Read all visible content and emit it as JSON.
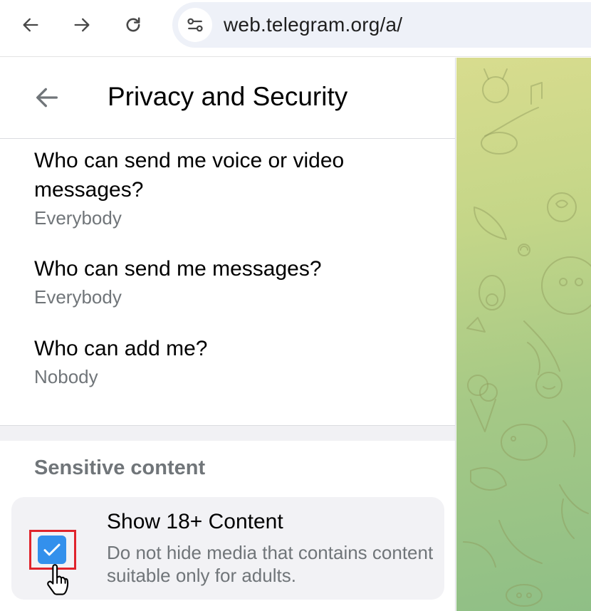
{
  "browser": {
    "url": "web.telegram.org/a/",
    "back_icon": "arrow-left-icon",
    "forward_icon": "arrow-right-icon",
    "reload_icon": "reload-icon",
    "site_info_icon": "tune-icon"
  },
  "header": {
    "title": "Privacy and Security",
    "back_icon": "arrow-left-icon"
  },
  "settings": [
    {
      "label": "Who can send me voice or video messages?",
      "value": "Everybody"
    },
    {
      "label": "Who can send me messages?",
      "value": "Everybody"
    },
    {
      "label": "Who can add me?",
      "value": "Nobody"
    }
  ],
  "sensitive": {
    "section_title": "Sensitive content",
    "option": {
      "title": "Show 18+ Content",
      "description": "Do not hide media that contains content suitable only for adults.",
      "checked": true
    }
  },
  "colors": {
    "accent": "#3390ec",
    "secondary_text": "#707579",
    "highlight_border": "#e0242c"
  }
}
